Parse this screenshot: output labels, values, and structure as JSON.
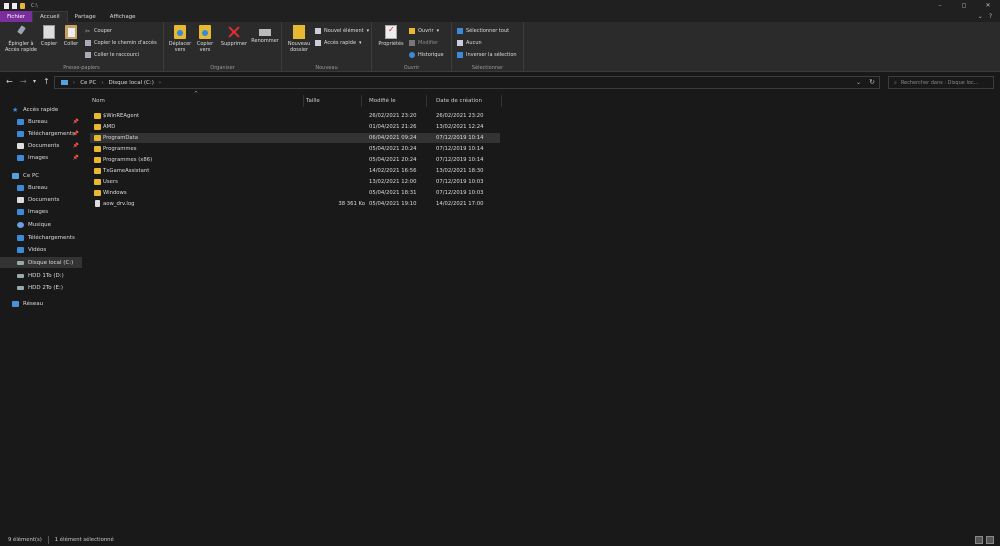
{
  "window": {
    "title": "C:\\",
    "controls": [
      "–",
      "◻",
      "✕"
    ]
  },
  "tabs": [
    {
      "label": "Fichier"
    },
    {
      "label": "Accueil"
    },
    {
      "label": "Partage"
    },
    {
      "label": "Affichage"
    }
  ],
  "ribbon": {
    "clipboard": {
      "pin_label": "Épingler à Accès rapide",
      "copy_label": "Copier",
      "paste_label": "Coller",
      "cut_label": "Couper",
      "copy_path_label": "Copier le chemin d'accès",
      "paste_shortcut_label": "Coller le raccourci",
      "group_label": "Presse-papiers"
    },
    "organize": {
      "move_label": "Déplacer vers",
      "copy_to_label": "Copier vers",
      "delete_label": "Supprimer",
      "rename_label": "Renommer",
      "group_label": "Organiser"
    },
    "new": {
      "new_folder_label": "Nouveau dossier",
      "new_item_label": "Nouvel élément",
      "easy_access_label": "Accès rapide",
      "group_label": "Nouveau"
    },
    "open": {
      "properties_label": "Propriétés",
      "open_label": "Ouvrir",
      "edit_label": "Modifier",
      "history_label": "Historique",
      "group_label": "Ouvrir"
    },
    "select": {
      "select_all_label": "Sélectionner tout",
      "select_none_label": "Aucun",
      "invert_label": "Inverser la sélection",
      "group_label": "Sélectionner"
    }
  },
  "address": {
    "crumbs": [
      "Ce PC",
      "Disque local (C:)"
    ],
    "search_placeholder": "Rechercher dans : Disque loc..."
  },
  "nav": {
    "quick_access": "Accès rapide",
    "quick_items": [
      "Bureau",
      "Téléchargements",
      "Documents",
      "Images"
    ],
    "this_pc": "Ce PC",
    "pc_items": [
      "Bureau",
      "Documents",
      "Images",
      "Musique",
      "Téléchargements",
      "Vidéos",
      "Disque local (C:)",
      "HDD 1To (D:)",
      "HDD 2To (E:)"
    ],
    "network": "Réseau"
  },
  "columns": {
    "name": "Nom",
    "size": "Taille",
    "modified": "Modifié le",
    "created": "Date de création"
  },
  "files": [
    {
      "name": "$WinREAgent",
      "size": "",
      "modified": "26/02/2021 23:20",
      "created": "26/02/2021 23:20",
      "type": "folder"
    },
    {
      "name": "AMD",
      "size": "",
      "modified": "01/04/2021 21:26",
      "created": "13/02/2021 12:24",
      "type": "folder"
    },
    {
      "name": "ProgramData",
      "size": "",
      "modified": "06/04/2021 09:24",
      "created": "07/12/2019 10:14",
      "type": "folder"
    },
    {
      "name": "Programmes",
      "size": "",
      "modified": "05/04/2021 20:24",
      "created": "07/12/2019 10:14",
      "type": "folder"
    },
    {
      "name": "Programmes (x86)",
      "size": "",
      "modified": "05/04/2021 20:24",
      "created": "07/12/2019 10:14",
      "type": "folder"
    },
    {
      "name": "TxGameAssistant",
      "size": "",
      "modified": "14/02/2021 16:56",
      "created": "13/02/2021 18:30",
      "type": "folder"
    },
    {
      "name": "Users",
      "size": "",
      "modified": "13/02/2021 12:00",
      "created": "07/12/2019 10:03",
      "type": "folder"
    },
    {
      "name": "Windows",
      "size": "",
      "modified": "05/04/2021 18:31",
      "created": "07/12/2019 10:03",
      "type": "folder"
    },
    {
      "name": "aow_drv.log",
      "size": "38 361 Ko",
      "modified": "05/04/2021 19:10",
      "created": "14/02/2021 17:00",
      "type": "file"
    }
  ],
  "status": {
    "count": "9 élément(s)",
    "selection": "1 élément sélectionné"
  }
}
